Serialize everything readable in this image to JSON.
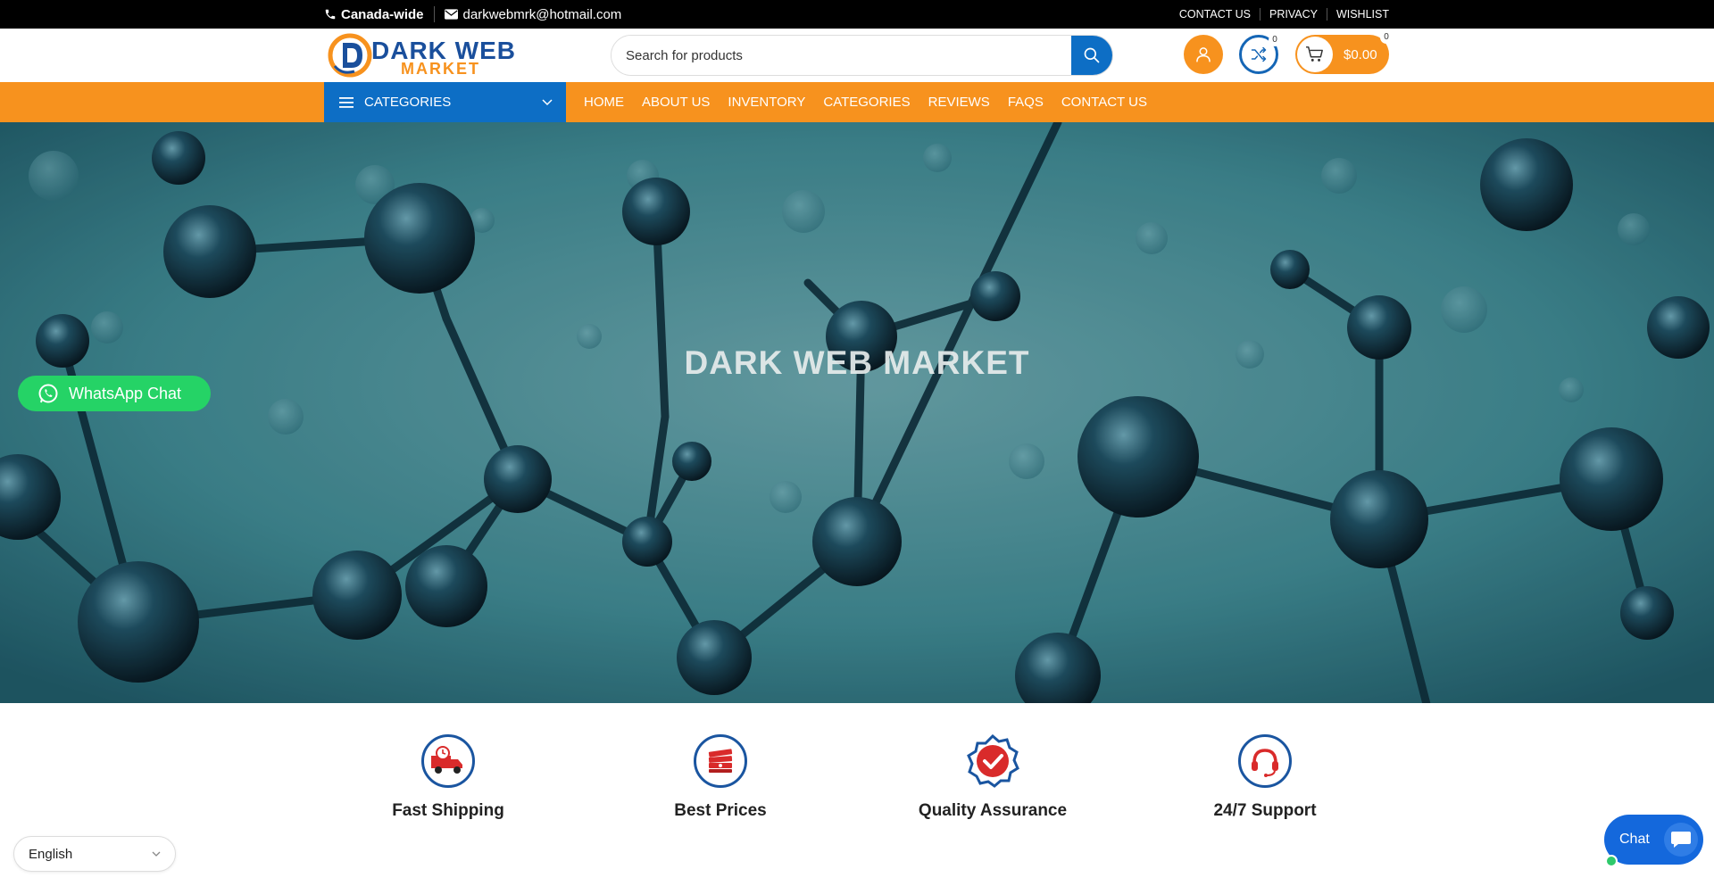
{
  "topbar": {
    "phone_text": "Canada-wide",
    "email_text": "darkwebmrk@hotmail.com",
    "links": [
      "CONTACT US",
      "PRIVACY",
      "WISHLIST"
    ]
  },
  "header": {
    "logo_line1": "DARK WEB",
    "logo_line2": "MARKET",
    "search_placeholder": "Search for products",
    "compare_count": "0",
    "cart_count": "0",
    "cart_amount": "$0.00"
  },
  "nav": {
    "categories_label": "CATEGORIES",
    "links": [
      "HOME",
      "ABOUT US",
      "INVENTORY",
      "CATEGORIES",
      "REVIEWS",
      "FAQS",
      "CONTACT US"
    ]
  },
  "hero": {
    "title": "DARK WEB MARKET"
  },
  "whatsapp": {
    "label": "WhatsApp Chat"
  },
  "features": [
    {
      "label": "Fast Shipping",
      "icon": "truck-icon"
    },
    {
      "label": "Best Prices",
      "icon": "money-stack-icon"
    },
    {
      "label": "Quality Assurance",
      "icon": "check-badge-icon"
    },
    {
      "label": "24/7 Support",
      "icon": "headset-icon"
    }
  ],
  "language": {
    "selected": "English"
  },
  "chat": {
    "label": "Chat"
  },
  "colors": {
    "orange": "#f7921e",
    "blue": "#0d6ec5",
    "topbar": "#000000",
    "whatsapp": "#25d366"
  }
}
